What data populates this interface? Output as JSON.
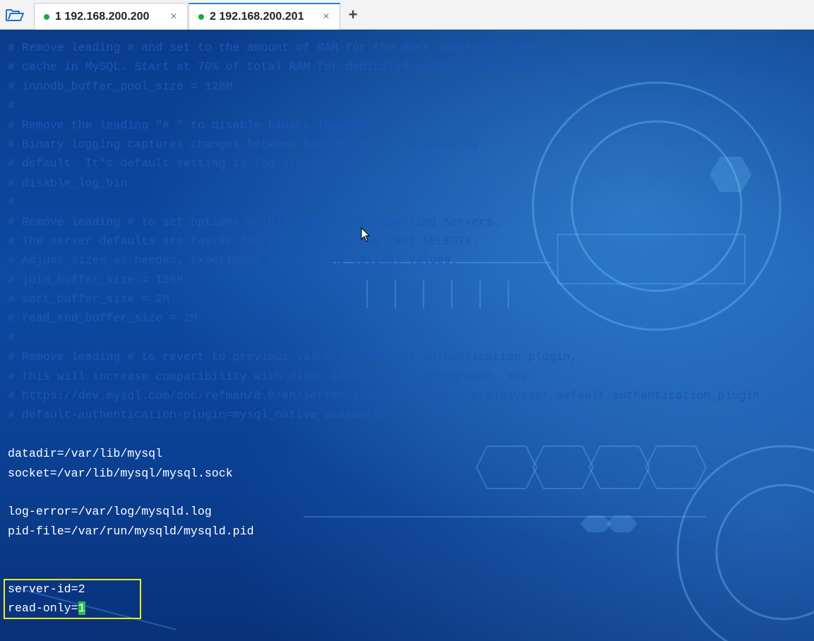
{
  "tabs": [
    {
      "index": "1",
      "host": "192.168.200.200",
      "label": "1 192.168.200.200",
      "status_color": "#1aa83b",
      "active": false
    },
    {
      "index": "2",
      "host": "192.168.200.201",
      "label": "2 192.168.200.201",
      "status_color": "#1aa83b",
      "active": true
    }
  ],
  "toolbar": {
    "folder_icon": "folder-open-icon",
    "add_tab_label": "+",
    "close_glyph": "×"
  },
  "terminal": {
    "lines": [
      {
        "type": "comment",
        "text": "# Remove leading # and set to the amount of RAM for the most important data"
      },
      {
        "type": "comment",
        "text": "# cache in MySQL. Start at 70% of total RAM for dedicated server, else 10%."
      },
      {
        "type": "comment",
        "text": "# innodb_buffer_pool_size = 128M"
      },
      {
        "type": "comment",
        "text": "#"
      },
      {
        "type": "comment",
        "text": "# Remove the leading \"# \" to disable binary logging"
      },
      {
        "type": "comment",
        "text": "# Binary logging captures changes between backups and is enabled by"
      },
      {
        "type": "comment",
        "text": "# default. It's default setting is log_bin=binlog"
      },
      {
        "type": "comment",
        "text": "# disable_log_bin"
      },
      {
        "type": "comment",
        "text": "#"
      },
      {
        "type": "comment",
        "text": "# Remove leading # to set options mainly useful for reporting servers."
      },
      {
        "type": "comment",
        "text": "# The server defaults are faster for transactions and fast SELECTs."
      },
      {
        "type": "comment",
        "text": "# Adjust sizes as needed, experiment to find the optimal values."
      },
      {
        "type": "comment",
        "text": "# join_buffer_size = 128M"
      },
      {
        "type": "comment",
        "text": "# sort_buffer_size = 2M"
      },
      {
        "type": "comment",
        "text": "# read_rnd_buffer_size = 2M"
      },
      {
        "type": "comment",
        "text": "#"
      },
      {
        "type": "comment",
        "text": "# Remove leading # to revert to previous value for default authentication plugin,"
      },
      {
        "type": "comment",
        "text": "# this will increase compatibility with older clients. For background, see:"
      },
      {
        "type": "comment",
        "text": "# https://dev.mysql.com/doc/refman/8.0/en/server-system-variables.html#sysvar_default_authentication_plugin"
      },
      {
        "type": "comment",
        "text": "# default-authentication-plugin=mysql_native_password"
      },
      {
        "type": "blank",
        "text": ""
      },
      {
        "type": "config",
        "text": "datadir=/var/lib/mysql"
      },
      {
        "type": "config",
        "text": "socket=/var/lib/mysql/mysql.sock"
      },
      {
        "type": "blank",
        "text": ""
      },
      {
        "type": "config",
        "text": "log-error=/var/log/mysqld.log"
      },
      {
        "type": "config",
        "text": "pid-file=/var/run/mysqld/mysqld.pid"
      },
      {
        "type": "blank",
        "text": ""
      },
      {
        "type": "blank",
        "text": ""
      },
      {
        "type": "config",
        "text": "server-id=2"
      }
    ],
    "cursor_line": {
      "prefix": "read-only=",
      "cursor_char": "1"
    },
    "colors": {
      "comment": "#1f55b8",
      "config": "#ffffff",
      "cursor": "#2bbf4a",
      "highlight_box": "#f5ea14"
    }
  }
}
